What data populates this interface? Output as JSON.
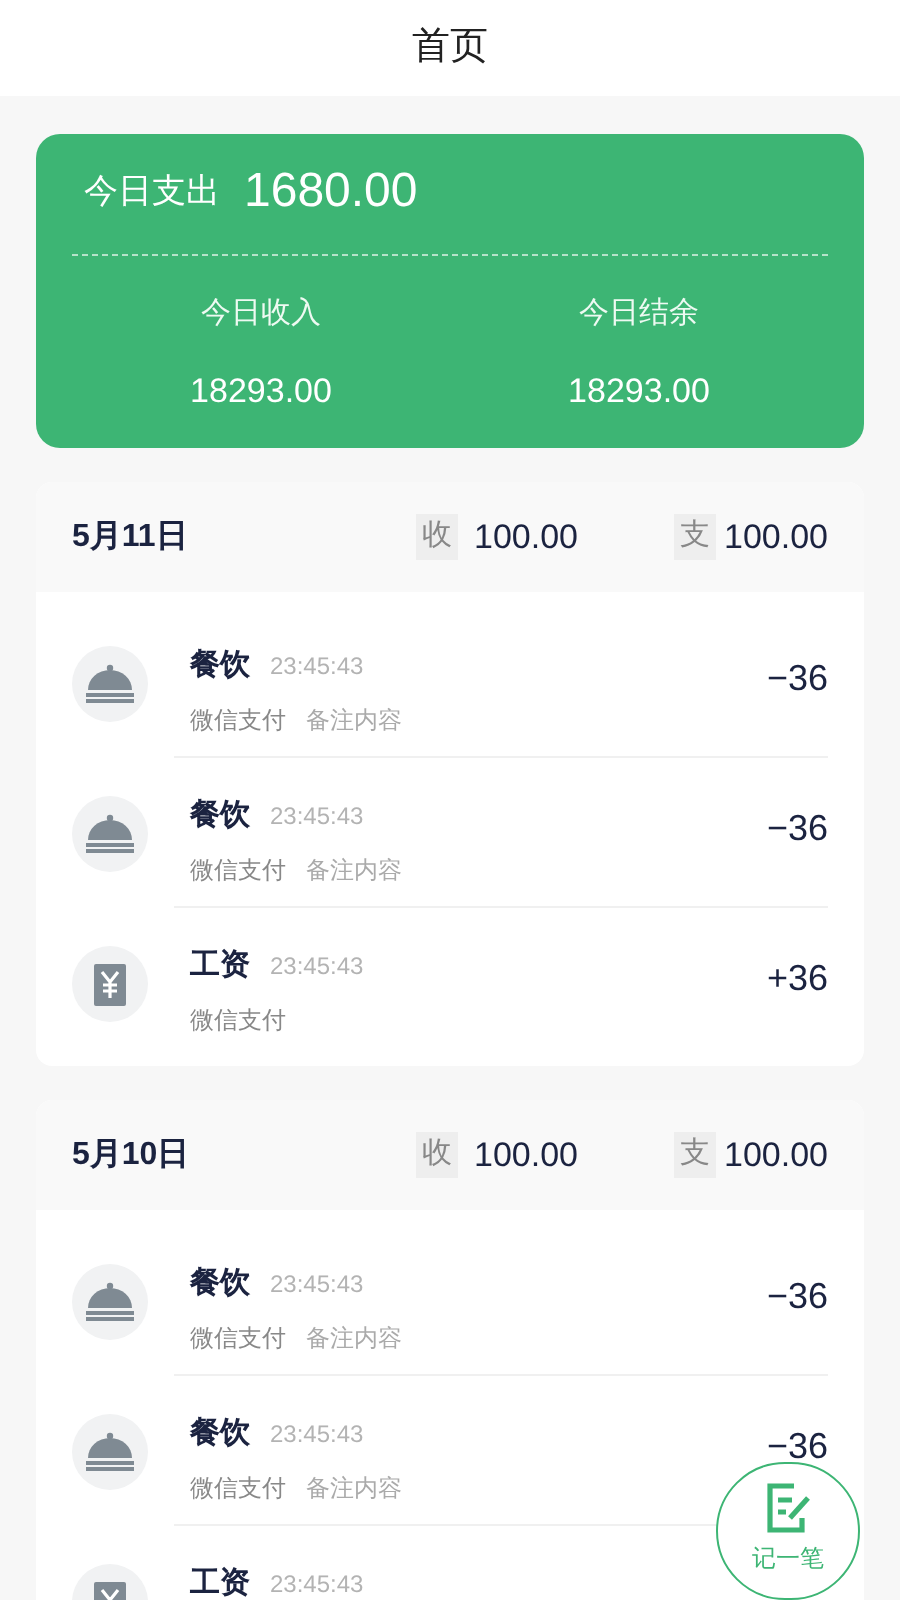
{
  "header": {
    "title": "首页"
  },
  "summary": {
    "expense_label": "今日支出",
    "expense": "1680.00",
    "stats": [
      {
        "label": "今日收入",
        "value": "18293.00"
      },
      {
        "label": "今日结余",
        "value": "18293.00"
      }
    ]
  },
  "days": [
    {
      "date": "5月11日",
      "income_tag": "收",
      "income": "100.00",
      "expense_tag": "支",
      "expense": "100.00",
      "items": [
        {
          "kind": "food",
          "title": "餐饮",
          "time": "23:45:43",
          "method": "微信支付",
          "note": "备注内容",
          "amount": "−36"
        },
        {
          "kind": "food",
          "title": "餐饮",
          "time": "23:45:43",
          "method": "微信支付",
          "note": "备注内容",
          "amount": "−36"
        },
        {
          "kind": "salary",
          "title": "工资",
          "time": "23:45:43",
          "method": "微信支付",
          "amount": "+36"
        }
      ]
    },
    {
      "date": "5月10日",
      "income_tag": "收",
      "income": "100.00",
      "expense_tag": "支",
      "expense": "100.00",
      "items": [
        {
          "kind": "food",
          "title": "餐饮",
          "time": "23:45:43",
          "method": "微信支付",
          "note": "备注内容",
          "amount": "−36"
        },
        {
          "kind": "food",
          "title": "餐饮",
          "time": "23:45:43",
          "method": "微信支付",
          "note": "备注内容",
          "amount": "−36"
        },
        {
          "kind": "salary",
          "title": "工资",
          "time": "23:45:43"
        }
      ]
    }
  ],
  "fab": {
    "label": "记一笔"
  }
}
